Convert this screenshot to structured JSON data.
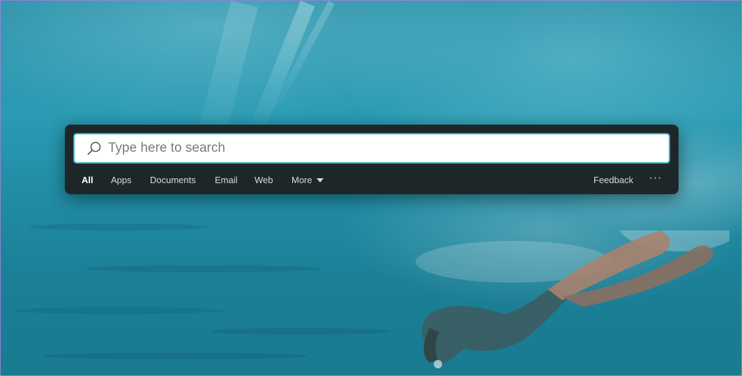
{
  "search": {
    "placeholder": "Type here to search",
    "value": ""
  },
  "filters": {
    "tabs": [
      {
        "label": "All",
        "active": true
      },
      {
        "label": "Apps",
        "active": false
      },
      {
        "label": "Documents",
        "active": false
      },
      {
        "label": "Email",
        "active": false
      },
      {
        "label": "Web",
        "active": false
      },
      {
        "label": "More",
        "active": false
      }
    ],
    "feedback_label": "Feedback",
    "overflow_label": "···"
  },
  "icons": {
    "search": "search-icon",
    "more_caret": "caret-down-icon",
    "overflow": "more-options-icon"
  },
  "colors": {
    "panel_bg": "#1d2729",
    "search_border": "#36b1c6",
    "active_tab": "#ffffff",
    "tab_text": "#d8dcdd",
    "wallpaper_water": "#2a9bb3"
  }
}
